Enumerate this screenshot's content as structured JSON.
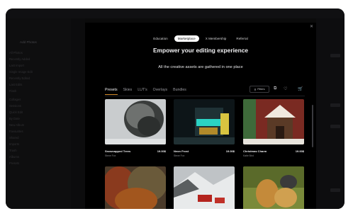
{
  "background": {
    "add_photos": "Add Photos",
    "left_items": [
      "All Photos",
      "Recently Added",
      "Last Import",
      "Single Image Edit",
      "Recently Edited",
      "Last Edits",
      "Flash",
      "Collages",
      "Sessions",
      "Quick Edit",
      "By Date",
      "New Album",
      "Favourites",
      "Shared",
      "Imports",
      "Trash",
      "Albums",
      "Presets"
    ]
  },
  "modal": {
    "close_icon": "close-icon",
    "tabs": [
      {
        "label": "Education",
        "active": false
      },
      {
        "label": "Marketplace",
        "active": true
      },
      {
        "label": "X Membership",
        "active": false
      },
      {
        "label": "Referral",
        "active": false
      }
    ],
    "title": "Empower your editing experience",
    "subtitle": "All the creative assets are gathered in one place",
    "categories": [
      {
        "label": "Presets",
        "active": true
      },
      {
        "label": "Skies",
        "active": false
      },
      {
        "label": "LUT's",
        "active": false
      },
      {
        "label": "Overlays",
        "active": false
      },
      {
        "label": "Bundles",
        "active": false
      }
    ],
    "filters_label": "Filters",
    "icons": [
      "filter-icon",
      "compare-icon",
      "heart-icon",
      "cart-icon"
    ],
    "products": [
      {
        "name": "Snowcapped Trees",
        "price": "19.00$",
        "author": "Steve Fox"
      },
      {
        "name": "Neon Frost",
        "price": "19.00$",
        "author": "Steve Fox"
      },
      {
        "name": "Christmas Charm",
        "price": "19.00$",
        "author": "Katie Bird"
      },
      {
        "name": "",
        "price": "",
        "author": ""
      },
      {
        "name": "",
        "price": "",
        "author": ""
      },
      {
        "name": "",
        "price": "",
        "author": ""
      }
    ]
  }
}
